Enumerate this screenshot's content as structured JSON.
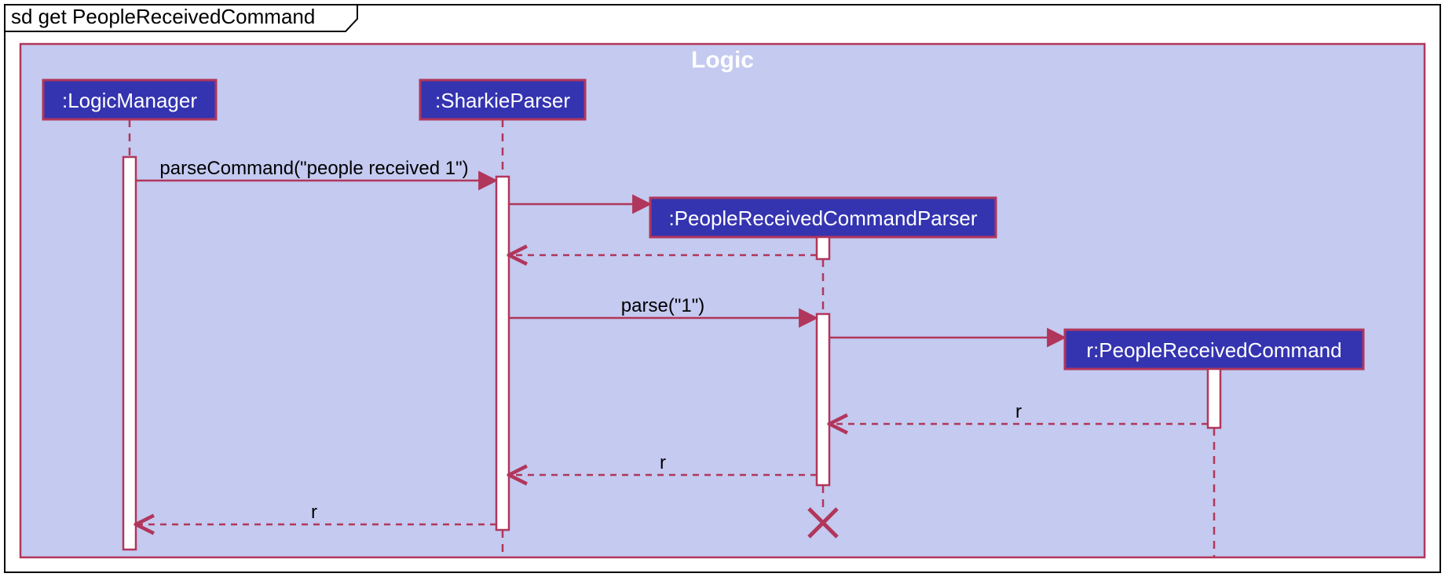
{
  "diagram": {
    "title": "sd get PeopleReceivedCommand",
    "package_label": "Logic",
    "lifelines": {
      "logic_manager": ":LogicManager",
      "sharkie_parser": ":SharkieParser",
      "prcp": ":PeopleReceivedCommandParser",
      "prc": "r:PeopleReceivedCommand"
    },
    "messages": {
      "parse_command": "parseCommand(\"people received 1\")",
      "parse": "parse(\"1\")",
      "return_r_1": "r",
      "return_r_2": "r",
      "return_r_3": "r"
    }
  }
}
